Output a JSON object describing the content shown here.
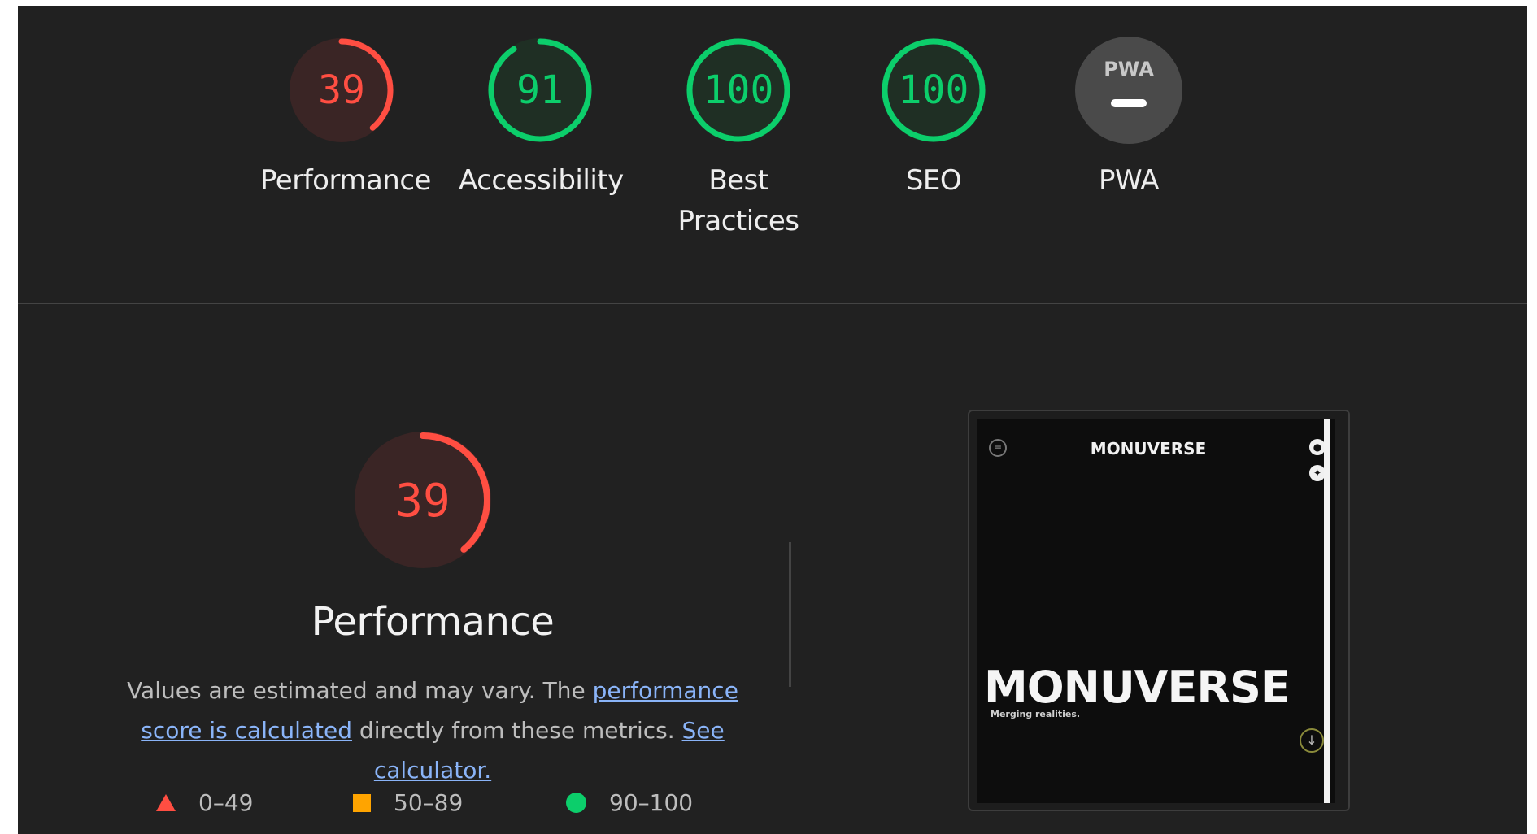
{
  "categories": [
    {
      "id": "performance",
      "label": "Performance",
      "score": "39",
      "fraction": 0.39,
      "status": "fail"
    },
    {
      "id": "accessibility",
      "label": "Accessibility",
      "score": "91",
      "fraction": 0.91,
      "status": "pass"
    },
    {
      "id": "best-practices",
      "label": "Best Practices",
      "label_line1": "Best",
      "label_line2": "Practices",
      "score": "100",
      "fraction": 1.0,
      "status": "pass"
    },
    {
      "id": "seo",
      "label": "SEO",
      "score": "100",
      "fraction": 1.0,
      "status": "pass"
    },
    {
      "id": "pwa",
      "label": "PWA",
      "badge_text": "PWA",
      "score": "",
      "status": "na"
    }
  ],
  "colors": {
    "fail": "#ff4e42",
    "fail_bg": "#3a2525",
    "average": "#ffa400",
    "pass": "#0cce6b",
    "pass_bg": "#1f2f24",
    "na_bg": "#4a4a4a",
    "link": "#8ab4f8"
  },
  "detail": {
    "score": "39",
    "fraction": 0.39,
    "title": "Performance",
    "desc_prefix": "Values are estimated and may vary. The ",
    "link1_text": "performance score is calculated",
    "desc_middle": " directly from these metrics.",
    "link2_text": "See calculator."
  },
  "legend": [
    {
      "icon": "triangle-icon",
      "range": "0–49"
    },
    {
      "icon": "square-icon",
      "range": "50–89"
    },
    {
      "icon": "circle-icon",
      "range": "90–100"
    }
  ],
  "screenshot": {
    "header_logo": "MONUVERSE",
    "hero_title": "MONUVERSE",
    "tagline": "Merging realities."
  }
}
